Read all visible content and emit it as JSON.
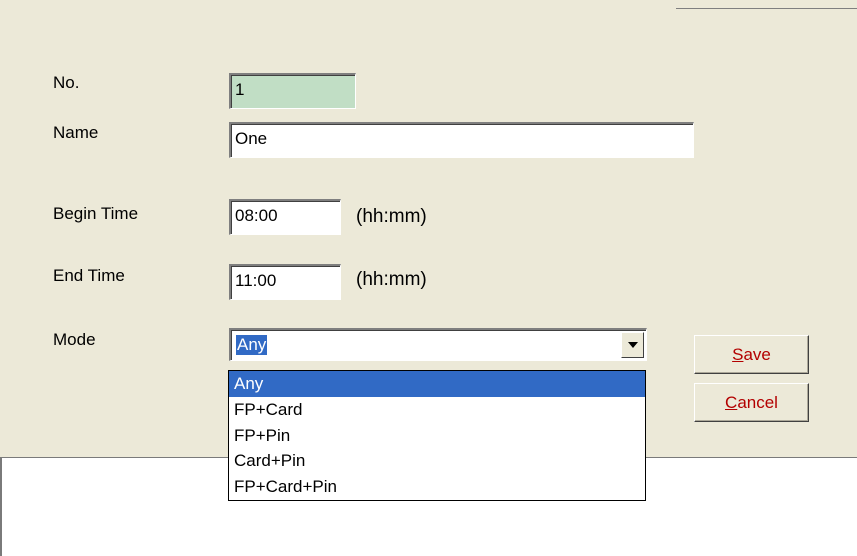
{
  "form": {
    "no_label": "No.",
    "no_value": "1",
    "name_label": "Name",
    "name_value": "One",
    "begin_label": "Begin Time",
    "begin_value": "08:00",
    "begin_hint": "(hh:mm)",
    "end_label": "End Time",
    "end_value": "11:00",
    "end_hint": "(hh:mm)",
    "mode_label": "Mode",
    "mode_value": "Any",
    "mode_options": [
      "Any",
      "FP+Card",
      "FP+Pin",
      "Card+Pin",
      "FP+Card+Pin"
    ],
    "mode_highlighted_index": 0
  },
  "buttons": {
    "save_mnemonic": "S",
    "save_rest": "ave",
    "cancel_mnemonic": "C",
    "cancel_rest": "ancel"
  },
  "colors": {
    "dialog_bg": "#ece9d8",
    "readonly_field": "#c1dec5",
    "selection": "#316ac5",
    "button_text": "#b30000"
  }
}
